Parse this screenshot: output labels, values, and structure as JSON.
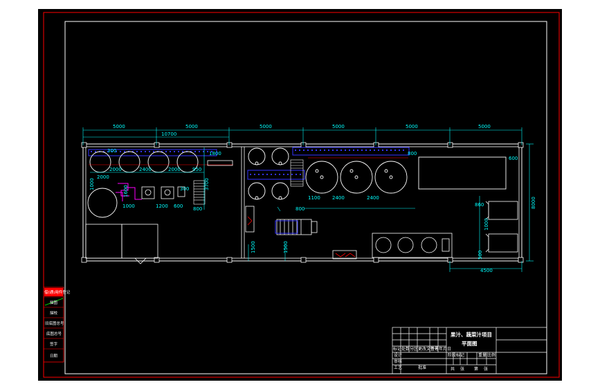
{
  "drawing": {
    "colors": {
      "background": "#000000",
      "outer_border": "#ff0000",
      "inner_border": "#ffffff",
      "walls": "#ffffff",
      "dimensions": "#00ffff",
      "conveyor": "#3333ff",
      "piping": "#ff00ff",
      "stamp_fill": "#ff0000"
    },
    "dims_top": [
      "5000",
      "5000",
      "5000",
      "5000",
      "5000",
      "5000"
    ],
    "dim_left_secondary": "10700",
    "dims_left_room": [
      "300",
      "2000",
      "2400",
      "2000",
      "950",
      "1800",
      "2000",
      "1000",
      "3700",
      "1600",
      "300",
      "1200",
      "600",
      "800"
    ],
    "dims_mid": [
      "800",
      "1100",
      "2400",
      "2400",
      "800"
    ],
    "dims_right": [
      "600",
      "800",
      "860",
      "1000",
      "500"
    ],
    "dim_bottom_right": "4500",
    "dims_bottom_left": [
      "1500",
      "1500"
    ],
    "dim_overall_right": "8000",
    "title_block": {
      "project_title": "果汁、蔬菜汁项目",
      "drawing_name": "平面图",
      "header_labels": [
        "标记",
        "处数",
        "分区",
        "更改文件号",
        "签名",
        "年月日"
      ],
      "row_labels": [
        "设计",
        "审核",
        "工艺",
        "批准"
      ],
      "stage_labels": [
        "阶段标记",
        "重量",
        "比例"
      ],
      "sheet_labels": [
        "共",
        "张",
        "第",
        "张"
      ]
    },
    "side_stamp": {
      "cells": [
        "借(通)用件登记",
        "描图",
        "描校",
        "旧底图总号",
        "底图总号",
        "签字",
        "日期"
      ]
    }
  }
}
